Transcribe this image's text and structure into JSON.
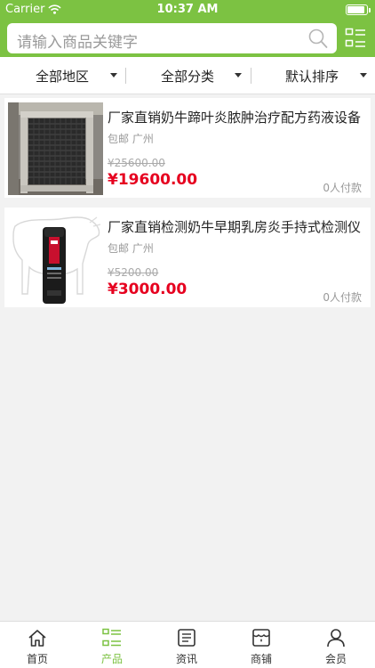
{
  "status_bar": {
    "carrier": "Carrier",
    "time": "10:37 AM",
    "battery_level": 0.9
  },
  "search": {
    "placeholder": "请输入商品关键字",
    "icon": "search-icon"
  },
  "header": {
    "list_toggle_icon": "list-view-icon",
    "brand_color": "#7cc242"
  },
  "filters": [
    {
      "label": "全部地区"
    },
    {
      "label": "全部分类"
    },
    {
      "label": "默认排序"
    }
  ],
  "products": [
    {
      "title": "厂家直销奶牛蹄叶炎脓肿治疗配方药液设备",
      "shipping": "包邮",
      "location": "广州",
      "original_price": "¥25600.00",
      "price": "¥19600.00",
      "paid": "0人付款"
    },
    {
      "title": "厂家直销检测奶牛早期乳房炎手持式检测仪",
      "shipping": "包邮",
      "location": "广州",
      "original_price": "¥5200.00",
      "price": "¥3000.00",
      "paid": "0人付款"
    }
  ],
  "tabs": [
    {
      "label": "首页",
      "icon": "home-icon",
      "active": false
    },
    {
      "label": "产品",
      "icon": "list-icon",
      "active": true
    },
    {
      "label": "资讯",
      "icon": "news-icon",
      "active": false
    },
    {
      "label": "商铺",
      "icon": "shop-icon",
      "active": false
    },
    {
      "label": "会员",
      "icon": "user-icon",
      "active": false
    }
  ],
  "colors": {
    "accent": "#7cc242",
    "price": "#e6001f"
  }
}
